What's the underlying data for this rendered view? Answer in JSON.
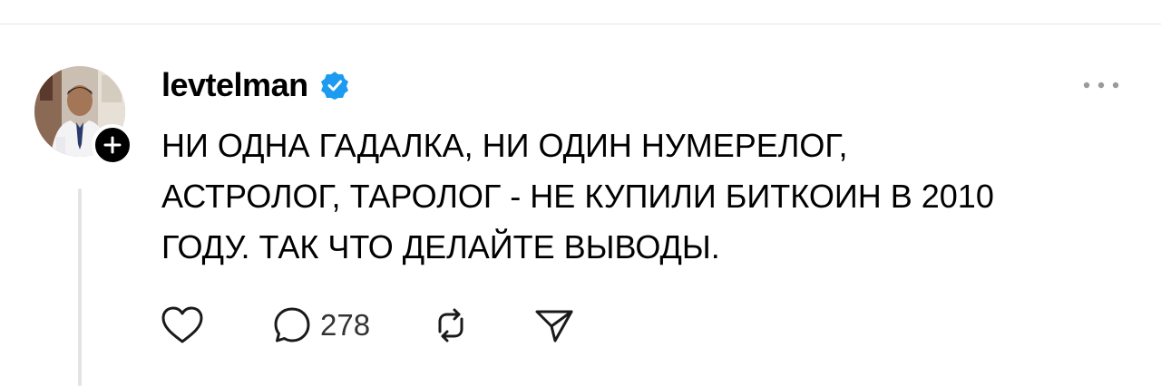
{
  "post": {
    "username": "levtelman",
    "verified": true,
    "text": "НИ ОДНА ГАДАЛКА, НИ ОДИН НУМЕРЕЛОГ,\nАСТРОЛОГ, ТАРОЛОГ - НЕ КУПИЛИ БИТКОИН В 2010\nГОДУ. ТАК ЧТО ДЕЛАЙТЕ ВЫВОДЫ.",
    "stats": {
      "replies": "278"
    }
  },
  "icons": {
    "avatar": "avatar",
    "follow": "plus-icon",
    "verified": "verified-badge-icon",
    "more": "more-horizontal-icon",
    "like": "heart-icon",
    "reply": "comment-bubble-icon",
    "repost": "repost-icon",
    "share": "send-icon"
  },
  "colors": {
    "text": "#000000",
    "verified_blue": "#1d9bf0",
    "icon_stroke": "#1a1a1a",
    "thread_line": "#e3e3e3"
  }
}
